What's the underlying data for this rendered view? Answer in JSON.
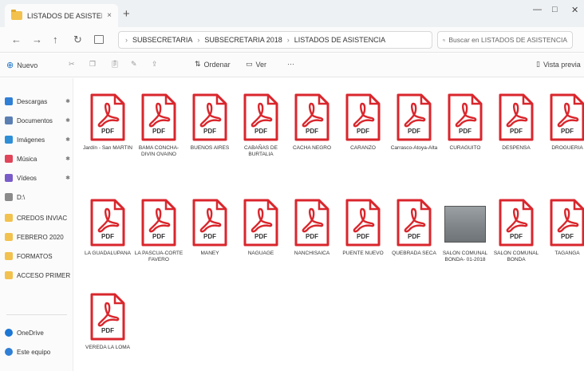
{
  "window": {
    "tab_title": "LISTADOS DE ASISTENCIA",
    "tab_close": "×",
    "new_tab": "+",
    "minimize": "—",
    "maximize": "□",
    "close": "✕"
  },
  "addressbar": {
    "back": "←",
    "forward": "→",
    "up": "↑",
    "refresh": "↻",
    "breadcrumb": [
      "SUBSECRETARIA",
      "SUBSECRETARIA 2018",
      "LISTADOS DE ASISTENCIA"
    ],
    "search_placeholder": "Buscar en LISTADOS DE ASISTENCIA"
  },
  "commandbar": {
    "new": "Nuevo",
    "sort": "Ordenar",
    "view": "Ver",
    "more": "···",
    "preview": "Vista previa"
  },
  "sidebar": {
    "items": [
      {
        "label": "Descargas",
        "color": "#2f7fd6"
      },
      {
        "label": "Documentos",
        "color": "#5b7fb3"
      },
      {
        "label": "Imágenes",
        "color": "#2f8fd6"
      },
      {
        "label": "Música",
        "color": "#e0455a"
      },
      {
        "label": "Vídeos",
        "color": "#7a5cc9"
      },
      {
        "label": "D:\\",
        "color": "#8a8a8a"
      },
      {
        "label": "CREDOS INVIAC",
        "color": "#f2c14e"
      },
      {
        "label": "FEBRERO 2020",
        "color": "#f2c14e"
      },
      {
        "label": "FORMATOS",
        "color": "#f2c14e"
      },
      {
        "label": "ACCESO PRIMERA",
        "color": "#f2c14e"
      }
    ],
    "bottom": [
      {
        "label": "OneDrive",
        "color": "#1c76d4"
      },
      {
        "label": "Este equipo",
        "color": "#2f7fd6"
      }
    ]
  },
  "files": [
    {
      "name": "Jardín - San MARTIN",
      "type": "pdf"
    },
    {
      "name": "BAMA CONCHA-DIVIN OVAINO",
      "type": "pdf"
    },
    {
      "name": "BUENOS AIRES",
      "type": "pdf"
    },
    {
      "name": "CABAÑAS DE BURTALIA",
      "type": "pdf"
    },
    {
      "name": "CACHA NEGRO",
      "type": "pdf"
    },
    {
      "name": "CARANZO",
      "type": "pdf"
    },
    {
      "name": "Carrasco-Atoya-Alta",
      "type": "pdf"
    },
    {
      "name": "CURAGUITO",
      "type": "pdf"
    },
    {
      "name": "DESPENSA",
      "type": "pdf"
    },
    {
      "name": "DROGUERIA",
      "type": "pdf"
    },
    {
      "name": "LA GUADALUPANA",
      "type": "pdf"
    },
    {
      "name": "LA PASCUA-CORTE FAVERO",
      "type": "pdf"
    },
    {
      "name": "MANEY",
      "type": "pdf"
    },
    {
      "name": "NAGUAGE",
      "type": "pdf"
    },
    {
      "name": "NANCHISAICA",
      "type": "pdf"
    },
    {
      "name": "PUENTE NUEVO",
      "type": "pdf"
    },
    {
      "name": "QUEBRADA SECA",
      "type": "pdf"
    },
    {
      "name": "SALON COMUNAL BONDA- 01-2018",
      "type": "image"
    },
    {
      "name": "SALON COMUNAL BONDA",
      "type": "pdf"
    },
    {
      "name": "TAGANGA",
      "type": "pdf"
    },
    {
      "name": "VEREDA LA LOMA",
      "type": "pdf"
    }
  ],
  "pdf_badge": "PDF",
  "colors": {
    "pdf_red": "#d9262c",
    "folder": "#f2c14e"
  }
}
